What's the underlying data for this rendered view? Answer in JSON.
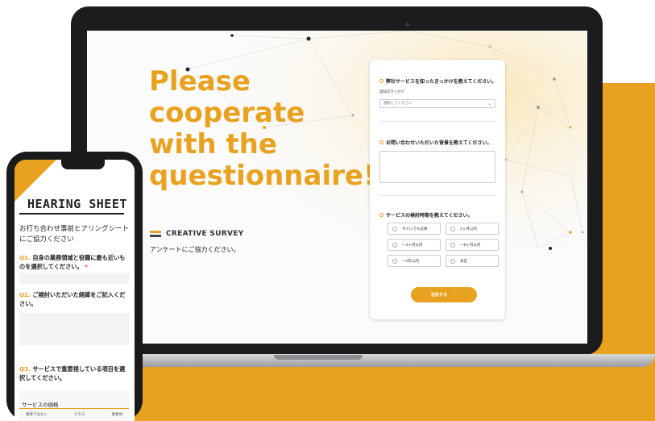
{
  "hero": {
    "title_line1": "Please",
    "title_line2": "cooperate",
    "title_line3": "with the",
    "title_line4": "questionnaire!",
    "logo_text": "CREATIVE SURVEY",
    "subtext": "アンケートにご協力ください。"
  },
  "form": {
    "q1": "弊社サービスを知ったきっかけを教えてください。",
    "q1_label": "認知のきっかけ",
    "q1_select": "選択してください",
    "q2": "お問い合わせいただいた背景を教えてください。",
    "q3": "サービスの検討時期を教えてください。",
    "options": [
      "すぐにでも必要",
      "1ヶ月以内",
      "〜3ヶ月以内",
      "〜6ヶ月以内",
      "〜1年以内",
      "未定"
    ],
    "submit_label": "送信する",
    "submit_arrow": "›"
  },
  "phone": {
    "time": "",
    "title": "HEARING SHEET",
    "intro": "お打ち合わせ事前ヒアリングシートにご協力ください",
    "q1_num": "Q1.",
    "q1_text": "自身の業務領域と役職に最も近いものを選択してください。",
    "q1_req": "*",
    "q2_num": "Q2.",
    "q2_text": "ご検討いただいた経緯をご記入ください。",
    "q3_num": "Q3.",
    "q3_text": "サービスで重要視している項目を選択してください。",
    "category": "サービスの価格",
    "col1": "重要ではない",
    "col2": "どちら",
    "col3": "重要視"
  },
  "colors": {
    "accent": "#e9a21f",
    "dark": "#1c1c1e"
  }
}
